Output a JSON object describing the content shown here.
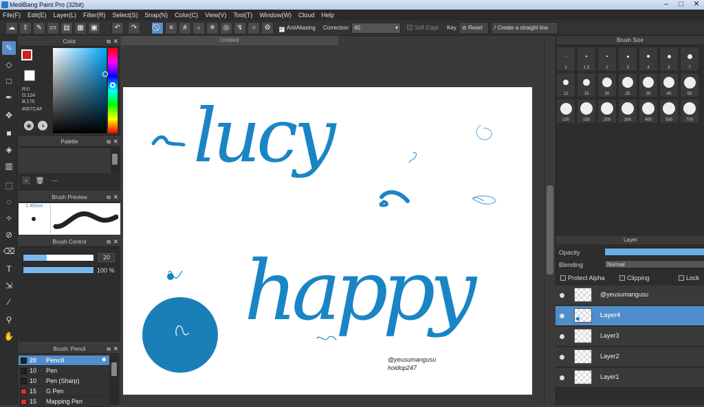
{
  "window": {
    "title": "MediBang Paint Pro (32bit)"
  },
  "menu": [
    "File(F)",
    "Edit(E)",
    "Layer(L)",
    "Filter(R)",
    "Select(S)",
    "Snap(N)",
    "Color(C)",
    "View(V)",
    "Tool(T)",
    "Window(W)",
    "Cloud",
    "Help"
  ],
  "toolbar": {
    "antialiasing_label": "AntiAliasing",
    "correction_label": "Correction",
    "correction_value": "40",
    "soft_edge_label": "Soft Edge",
    "key_label": "Key",
    "reset_label": "Reset",
    "straight_line_label": "Create a straight line"
  },
  "document": {
    "tab_title": "Untitled"
  },
  "color_panel": {
    "title": "Color",
    "r": "R:0",
    "g": "G:124",
    "b": "B:175",
    "hex": "#007CAF",
    "fg_color": "#d02020",
    "bg_color": "#000000"
  },
  "palette_panel": {
    "title": "Palette",
    "dots": "---"
  },
  "brush_preview": {
    "title": "Brush Preview",
    "size": "1.45mm"
  },
  "brush_control": {
    "title": "Brush Control",
    "size_value": "20",
    "opacity_value": "100 %",
    "size_fill": 0.33,
    "opacity_fill": 1.0
  },
  "brush_list": {
    "title": "Brush: Pencil",
    "items": [
      {
        "size": "20",
        "name": "Pencil",
        "color": "#222222"
      },
      {
        "size": "10",
        "name": "Pen",
        "color": "#222222"
      },
      {
        "size": "10",
        "name": "Pen (Sharp)",
        "color": "#222222"
      },
      {
        "size": "15",
        "name": "G Pen",
        "color": "#e03030"
      },
      {
        "size": "15",
        "name": "Mapping Pen",
        "color": "#e03030"
      }
    ]
  },
  "brush_size_panel": {
    "title": "Brush Size",
    "sizes": [
      "1",
      "1.5",
      "2",
      "3",
      "4",
      "5",
      "7",
      "12",
      "15",
      "20",
      "25",
      "30",
      "40",
      "50",
      "100",
      "150",
      "200",
      "300",
      "400",
      "500",
      "700"
    ]
  },
  "layer_panel": {
    "title": "Layer",
    "opacity_label": "Opacity",
    "blending_label": "Blending",
    "blending_value": "Normal",
    "protect_alpha_label": "Protect Alpha",
    "clipping_label": "Clipping",
    "lock_label": "Lock",
    "layers": [
      "@yeusumangusu",
      "Layer4",
      "Layer3",
      "Layer2",
      "Layer1"
    ]
  },
  "artwork": {
    "word1": "lucy",
    "word2": "happy",
    "signature_line1": "@yeusumangusu",
    "signature_line2": "hoidop247",
    "ink_color": "#1a85c4"
  }
}
